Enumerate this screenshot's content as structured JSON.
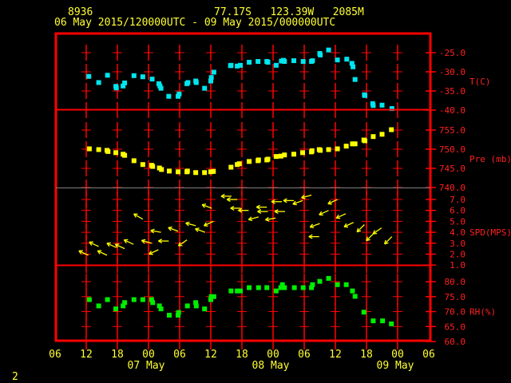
{
  "header": {
    "station_id": "8936",
    "location": "77.17S   123.39W   2085M",
    "period": "06 May 2015/120000UTC - 09 May 2015/000000UTC"
  },
  "footer": {
    "page": "2"
  },
  "colors": {
    "frame": "#ff0000",
    "text": "#ffff33",
    "temperature": "#00e5ee",
    "pressure": "#ffff00",
    "wind": "#ffff00",
    "rh": "#00ee00",
    "divider": "#808080"
  },
  "chart_data": {
    "type": "scatter",
    "x_axis": {
      "range": [
        "2015-05-06 06:00",
        "2015-05-09 06:00"
      ],
      "hour_ticks": [
        "06",
        "12",
        "18",
        "00",
        "06",
        "12",
        "18",
        "00",
        "06",
        "12",
        "18",
        "00",
        "06"
      ],
      "date_labels": [
        {
          "label": "07 May",
          "at": "2015-05-07 00:00"
        },
        {
          "label": "08 May",
          "at": "2015-05-08 00:00"
        },
        {
          "label": "09 May",
          "at": "2015-05-09 00:00"
        }
      ],
      "grid": true
    },
    "panels": [
      {
        "key": "temperature",
        "label": "T(C)",
        "ylim": [
          -40,
          -25
        ],
        "ticks": [
          "-25.0",
          "-30.0",
          "-35.0",
          "-40.0"
        ],
        "points": [
          [
            "2015-05-06 12:30",
            -31.2
          ],
          [
            "2015-05-06 14:24",
            -32.8
          ],
          [
            "2015-05-06 16:06",
            -30.9
          ],
          [
            "2015-05-06 17:42",
            -33.8
          ],
          [
            "2015-05-06 17:48",
            -34.2
          ],
          [
            "2015-05-06 19:06",
            -33.7
          ],
          [
            "2015-05-06 19:24",
            -32.9
          ],
          [
            "2015-05-06 21:12",
            -31.0
          ],
          [
            "2015-05-06 22:54",
            -31.3
          ],
          [
            "2015-05-07 00:42",
            -31.9
          ],
          [
            "2015-05-07 02:00",
            -33.1
          ],
          [
            "2015-05-07 02:12",
            -33.7
          ],
          [
            "2015-05-07 02:24",
            -34.3
          ],
          [
            "2015-05-07 03:54",
            -36.4
          ],
          [
            "2015-05-07 05:42",
            -36.4
          ],
          [
            "2015-05-07 05:54",
            -35.8
          ],
          [
            "2015-05-07 07:24",
            -33.1
          ],
          [
            "2015-05-07 07:36",
            -32.8
          ],
          [
            "2015-05-07 09:06",
            -32.4
          ],
          [
            "2015-05-07 09:12",
            -32.8
          ],
          [
            "2015-05-07 10:48",
            -34.3
          ],
          [
            "2015-05-07 12:00",
            -32.4
          ],
          [
            "2015-05-07 12:06",
            -31.5
          ],
          [
            "2015-05-07 12:36",
            -30.1
          ],
          [
            "2015-05-07 15:48",
            -28.4
          ],
          [
            "2015-05-07 15:54",
            -28.3
          ],
          [
            "2015-05-07 17:06",
            -28.5
          ],
          [
            "2015-05-07 17:42",
            -28.3
          ],
          [
            "2015-05-07 19:24",
            -27.5
          ],
          [
            "2015-05-07 21:06",
            -27.3
          ],
          [
            "2015-05-07 22:48",
            -27.3
          ],
          [
            "2015-05-07 23:00",
            -27.5
          ],
          [
            "2015-05-08 00:36",
            -28.3
          ],
          [
            "2015-05-08 01:36",
            -27.2
          ],
          [
            "2015-05-08 02:00",
            -27.0
          ],
          [
            "2015-05-08 02:12",
            -27.3
          ],
          [
            "2015-05-08 04:00",
            -27.1
          ],
          [
            "2015-05-08 05:48",
            -27.3
          ],
          [
            "2015-05-08 07:24",
            -27.3
          ],
          [
            "2015-05-08 07:36",
            -27.1
          ],
          [
            "2015-05-08 09:00",
            -25.2
          ],
          [
            "2015-05-08 09:06",
            -25.6
          ],
          [
            "2015-05-08 10:42",
            -24.3
          ],
          [
            "2015-05-08 12:24",
            -26.9
          ],
          [
            "2015-05-08 14:12",
            -26.7
          ],
          [
            "2015-05-08 15:12",
            -27.8
          ],
          [
            "2015-05-08 15:24",
            -28.7
          ],
          [
            "2015-05-08 15:48",
            -32.0
          ],
          [
            "2015-05-08 17:36",
            -36.0
          ],
          [
            "2015-05-08 17:42",
            -36.2
          ],
          [
            "2015-05-08 19:12",
            -38.3
          ],
          [
            "2015-05-08 19:18",
            -38.8
          ],
          [
            "2015-05-08 21:00",
            -38.7
          ],
          [
            "2015-05-08 22:54",
            -39.6
          ]
        ]
      },
      {
        "key": "pressure",
        "label": "Pre (mb)",
        "ylim": [
          740,
          755
        ],
        "ticks": [
          "755.0",
          "750.0",
          "745.0",
          "740.0"
        ],
        "points": [
          [
            "2015-05-06 12:36",
            750.1
          ],
          [
            "2015-05-06 14:24",
            749.9
          ],
          [
            "2015-05-06 16:00",
            749.7
          ],
          [
            "2015-05-06 16:12",
            749.4
          ],
          [
            "2015-05-06 17:42",
            749.1
          ],
          [
            "2015-05-06 19:06",
            748.7
          ],
          [
            "2015-05-06 19:24",
            748.4
          ],
          [
            "2015-05-06 21:12",
            747.0
          ],
          [
            "2015-05-06 22:54",
            746.0
          ],
          [
            "2015-05-07 00:36",
            745.8
          ],
          [
            "2015-05-07 00:48",
            745.5
          ],
          [
            "2015-05-07 02:06",
            745.1
          ],
          [
            "2015-05-07 02:30",
            744.7
          ],
          [
            "2015-05-07 04:00",
            744.3
          ],
          [
            "2015-05-07 05:42",
            744.1
          ],
          [
            "2015-05-07 07:24",
            744.1
          ],
          [
            "2015-05-07 07:30",
            744.3
          ],
          [
            "2015-05-07 09:06",
            743.9
          ],
          [
            "2015-05-07 10:48",
            743.9
          ],
          [
            "2015-05-07 12:00",
            744.1
          ],
          [
            "2015-05-07 12:30",
            744.2
          ],
          [
            "2015-05-07 15:54",
            745.3
          ],
          [
            "2015-05-07 17:06",
            746.0
          ],
          [
            "2015-05-07 17:30",
            746.2
          ],
          [
            "2015-05-07 19:24",
            746.8
          ],
          [
            "2015-05-07 21:06",
            747.0
          ],
          [
            "2015-05-07 21:12",
            747.2
          ],
          [
            "2015-05-07 22:48",
            747.2
          ],
          [
            "2015-05-07 23:00",
            747.4
          ],
          [
            "2015-05-08 00:36",
            748.1
          ],
          [
            "2015-05-08 01:30",
            748.2
          ],
          [
            "2015-05-08 02:12",
            748.5
          ],
          [
            "2015-05-08 04:00",
            748.7
          ],
          [
            "2015-05-08 05:42",
            749.1
          ],
          [
            "2015-05-08 07:24",
            749.3
          ],
          [
            "2015-05-08 07:30",
            749.6
          ],
          [
            "2015-05-08 08:54",
            749.9
          ],
          [
            "2015-05-08 09:06",
            749.7
          ],
          [
            "2015-05-08 10:42",
            749.9
          ],
          [
            "2015-05-08 12:24",
            750.1
          ],
          [
            "2015-05-08 14:06",
            750.8
          ],
          [
            "2015-05-08 15:18",
            751.4
          ],
          [
            "2015-05-08 15:48",
            751.4
          ],
          [
            "2015-05-08 17:30",
            752.4
          ],
          [
            "2015-05-08 17:42",
            752.2
          ],
          [
            "2015-05-08 19:18",
            753.3
          ],
          [
            "2015-05-08 21:00",
            753.9
          ],
          [
            "2015-05-08 22:48",
            755.1
          ]
        ]
      },
      {
        "key": "wind",
        "label": "SPD(MPS)",
        "ylim": [
          1,
          7
        ],
        "type": "arrows",
        "ticks": [
          "7.0",
          "6.0",
          "5.0",
          "4.0",
          "3.0",
          "2.0",
          "1.0"
        ],
        "points_note_fields": [
          "time",
          "speed",
          "arrow_heading_deg"
        ],
        "points": [
          [
            "2015-05-06 12:24",
            1.9,
            295
          ],
          [
            "2015-05-06 14:24",
            2.7,
            295
          ],
          [
            "2015-05-06 16:00",
            1.9,
            295
          ],
          [
            "2015-05-06 17:48",
            2.6,
            295
          ],
          [
            "2015-05-06 19:24",
            2.5,
            295
          ],
          [
            "2015-05-06 21:06",
            2.9,
            295
          ],
          [
            "2015-05-06 22:54",
            5.2,
            300
          ],
          [
            "2015-05-07 00:36",
            3.0,
            285
          ],
          [
            "2015-05-07 01:54",
            2.4,
            245
          ],
          [
            "2015-05-07 02:24",
            4.0,
            280
          ],
          [
            "2015-05-07 03:54",
            3.2,
            270
          ],
          [
            "2015-05-07 05:42",
            4.1,
            290
          ],
          [
            "2015-05-07 07:24",
            3.3,
            235
          ],
          [
            "2015-05-07 09:06",
            4.6,
            285
          ],
          [
            "2015-05-07 10:54",
            4.0,
            290
          ],
          [
            "2015-05-07 12:12",
            6.2,
            290
          ],
          [
            "2015-05-07 12:30",
            5.0,
            245
          ],
          [
            "2015-05-07 16:00",
            7.3,
            270
          ],
          [
            "2015-05-07 17:06",
            7.0,
            270
          ],
          [
            "2015-05-07 17:48",
            6.2,
            270
          ],
          [
            "2015-05-07 19:18",
            6.0,
            270
          ],
          [
            "2015-05-07 21:12",
            5.4,
            255
          ],
          [
            "2015-05-07 22:48",
            6.3,
            270
          ],
          [
            "2015-05-07 23:00",
            5.9,
            270
          ],
          [
            "2015-05-08 00:30",
            5.3,
            260
          ],
          [
            "2015-05-08 01:42",
            6.8,
            270
          ],
          [
            "2015-05-08 02:18",
            5.9,
            270
          ],
          [
            "2015-05-08 04:00",
            6.9,
            270
          ],
          [
            "2015-05-08 05:42",
            6.9,
            250
          ],
          [
            "2015-05-08 07:24",
            7.4,
            255
          ],
          [
            "2015-05-08 08:54",
            3.6,
            270
          ],
          [
            "2015-05-08 09:00",
            4.8,
            250
          ],
          [
            "2015-05-08 10:42",
            6.0,
            245
          ],
          [
            "2015-05-08 12:24",
            7.0,
            245
          ],
          [
            "2015-05-08 14:00",
            5.7,
            245
          ],
          [
            "2015-05-08 15:30",
            4.9,
            245
          ],
          [
            "2015-05-08 17:36",
            4.7,
            225
          ],
          [
            "2015-05-08 19:24",
            3.9,
            225
          ],
          [
            "2015-05-08 20:54",
            4.4,
            235
          ],
          [
            "2015-05-08 22:54",
            3.6,
            225
          ]
        ]
      },
      {
        "key": "rh",
        "label": "RH(%)",
        "ylim": [
          60,
          80
        ],
        "ticks": [
          "80.0",
          "75.0",
          "70.0",
          "65.0",
          "60.0"
        ],
        "points": [
          [
            "2015-05-06 12:36",
            74.0
          ],
          [
            "2015-05-06 14:24",
            71.9
          ],
          [
            "2015-05-06 16:06",
            74.0
          ],
          [
            "2015-05-06 17:42",
            70.9
          ],
          [
            "2015-05-06 19:06",
            71.9
          ],
          [
            "2015-05-06 19:24",
            73.0
          ],
          [
            "2015-05-06 21:12",
            74.0
          ],
          [
            "2015-05-06 22:54",
            74.0
          ],
          [
            "2015-05-07 00:36",
            74.0
          ],
          [
            "2015-05-07 00:48",
            73.0
          ],
          [
            "2015-05-07 02:06",
            71.9
          ],
          [
            "2015-05-07 02:24",
            70.9
          ],
          [
            "2015-05-07 04:00",
            68.8
          ],
          [
            "2015-05-07 05:42",
            68.8
          ],
          [
            "2015-05-07 05:48",
            69.7
          ],
          [
            "2015-05-07 07:30",
            71.9
          ],
          [
            "2015-05-07 09:06",
            73.0
          ],
          [
            "2015-05-07 09:12",
            71.9
          ],
          [
            "2015-05-07 10:48",
            70.9
          ],
          [
            "2015-05-07 12:00",
            74.0
          ],
          [
            "2015-05-07 12:06",
            75.0
          ],
          [
            "2015-05-07 12:36",
            75.0
          ],
          [
            "2015-05-07 15:54",
            76.9
          ],
          [
            "2015-05-07 17:06",
            76.9
          ],
          [
            "2015-05-07 17:42",
            76.9
          ],
          [
            "2015-05-07 19:24",
            78.0
          ],
          [
            "2015-05-07 21:12",
            78.0
          ],
          [
            "2015-05-07 22:48",
            78.0
          ],
          [
            "2015-05-08 00:36",
            76.9
          ],
          [
            "2015-05-08 01:30",
            78.0
          ],
          [
            "2015-05-08 01:48",
            79.0
          ],
          [
            "2015-05-08 02:12",
            78.0
          ],
          [
            "2015-05-08 04:06",
            78.0
          ],
          [
            "2015-05-08 05:48",
            78.0
          ],
          [
            "2015-05-08 07:24",
            78.0
          ],
          [
            "2015-05-08 07:36",
            79.0
          ],
          [
            "2015-05-08 09:00",
            80.1
          ],
          [
            "2015-05-08 10:42",
            81.1
          ],
          [
            "2015-05-08 12:24",
            79.0
          ],
          [
            "2015-05-08 14:06",
            79.0
          ],
          [
            "2015-05-08 15:18",
            76.9
          ],
          [
            "2015-05-08 15:48",
            75.1
          ],
          [
            "2015-05-08 17:30",
            69.8
          ],
          [
            "2015-05-08 19:18",
            66.9
          ],
          [
            "2015-05-08 21:06",
            66.9
          ],
          [
            "2015-05-08 22:48",
            65.9
          ]
        ]
      }
    ]
  }
}
